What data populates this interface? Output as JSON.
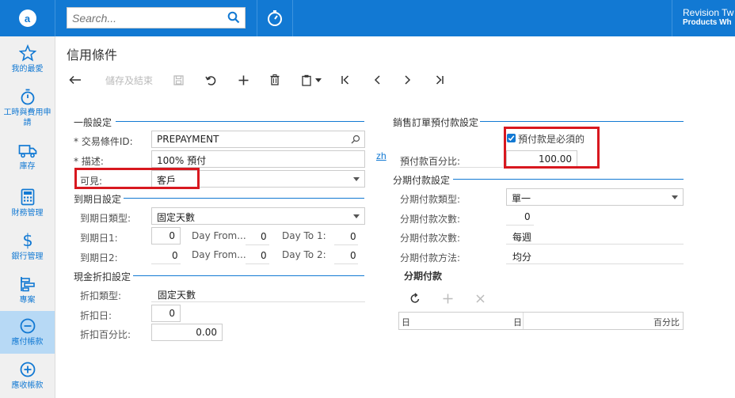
{
  "topbar": {
    "logo_letter": "a",
    "search_placeholder": "Search...",
    "company_line1": "Revision Tw",
    "company_line2": "Products Wh"
  },
  "sidebar": {
    "items": [
      {
        "label": "我的最愛",
        "icon": "star-icon"
      },
      {
        "label": "工時與費用申請",
        "icon": "stopwatch-icon"
      },
      {
        "label": "庫存",
        "icon": "truck-icon"
      },
      {
        "label": "財務管理",
        "icon": "calculator-icon"
      },
      {
        "label": "銀行管理",
        "icon": "dollar-icon"
      },
      {
        "label": "專案",
        "icon": "project-icon"
      },
      {
        "label": "應付帳款",
        "icon": "minus-circle-icon",
        "active": true
      },
      {
        "label": "應收帳款",
        "icon": "plus-circle-icon"
      }
    ]
  },
  "page": {
    "title": "信用條件"
  },
  "toolbar": {
    "save_close_label": "儲存及結束"
  },
  "general": {
    "section": "一般設定",
    "term_id_label": "* 交易條件ID:",
    "term_id_value": "PREPAYMENT",
    "desc_label": "* 描述:",
    "desc_value": "100% 預付",
    "visible_label": "可見:",
    "visible_value": "客戶",
    "lang_link": "zh"
  },
  "due": {
    "section": "到期日設定",
    "type_label": "到期日類型:",
    "type_value": "固定天數",
    "day1_label": "到期日1:",
    "day1_value": "0",
    "dayfrom1_label": "Day From...",
    "dayfrom1_value": "0",
    "dayto1_label": "Day To 1:",
    "dayto1_value": "0",
    "day2_label": "到期日2:",
    "day2_value": "0",
    "dayfrom2_label": "Day From...",
    "dayfrom2_value": "0",
    "dayto2_label": "Day To 2:",
    "dayto2_value": "0"
  },
  "discount": {
    "section": "現金折扣設定",
    "type_label": "折扣類型:",
    "type_value": "固定天數",
    "day_label": "折扣日:",
    "day_value": "0",
    "pct_label": "折扣百分比:",
    "pct_value": "0.00"
  },
  "prepay": {
    "section": "銷售訂單預付款設定",
    "required_label": "預付款是必須的",
    "required_checked": true,
    "pct_label": "預付款百分比:",
    "pct_value": "100.00"
  },
  "installment": {
    "section": "分期付款設定",
    "type_label": "分期付款類型:",
    "type_value": "單一",
    "count_label": "分期付款次數:",
    "count_value": "0",
    "freq_label": "分期付款次數:",
    "freq_value": "每週",
    "method_label": "分期付款方法:",
    "method_value": "均分",
    "grid_title": "分期付款",
    "grid_col1": "日",
    "grid_col1_prefix": "日",
    "grid_col2": "百分比"
  },
  "colors": {
    "accent": "#1279d3",
    "highlight_box": "#d8181f",
    "active_nav": "#b7d9f5"
  }
}
